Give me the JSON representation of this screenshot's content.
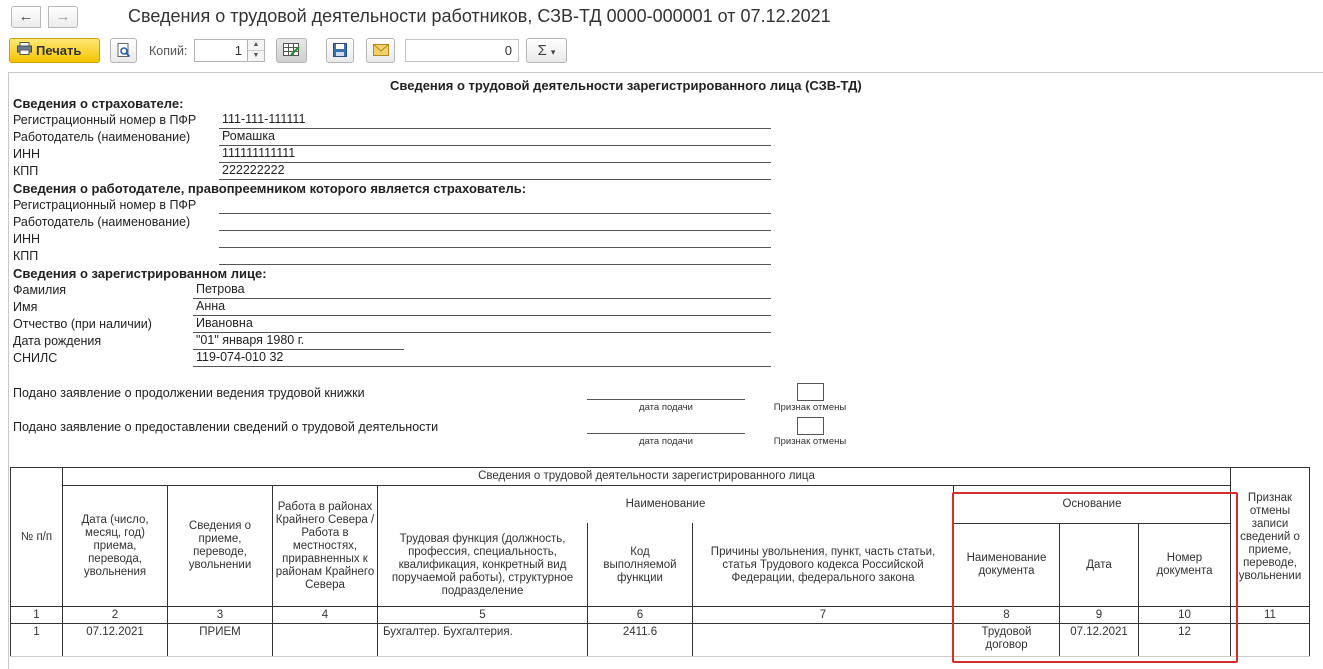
{
  "window": {
    "back": "←",
    "forward": "→",
    "title": "Сведения о трудовой деятельности работников, СЗВ-ТД 0000-000001 от 07.12.2021"
  },
  "toolbar": {
    "print_label": "Печать",
    "copies_label": "Копий:",
    "copies_value": "1",
    "sum_value": "0",
    "sigma": "Σ",
    "sigma_caret": "▾"
  },
  "document": {
    "title": "Сведения о трудовой деятельности зарегистрированного лица (СЗВ-ТД)",
    "insurer": {
      "heading": "Сведения о страхователе:",
      "fields": [
        {
          "label": "Регистрационный номер в ПФР",
          "value": "111-111-111111"
        },
        {
          "label": "Работодатель (наименование)",
          "value": "Ромашка"
        },
        {
          "label": "ИНН",
          "value": "111111111111"
        },
        {
          "label": "КПП",
          "value": "222222222"
        }
      ]
    },
    "predecessor": {
      "heading": "Сведения о работодателе, правопреемником которого является страхователь:",
      "fields": [
        {
          "label": "Регистрационный номер в ПФР",
          "value": ""
        },
        {
          "label": "Работодатель (наименование)",
          "value": ""
        },
        {
          "label": "ИНН",
          "value": ""
        },
        {
          "label": "КПП",
          "value": ""
        }
      ]
    },
    "person": {
      "heading": "Сведения о зарегистрированном лице:",
      "fields": [
        {
          "label": "Фамилия",
          "value": "Петрова"
        },
        {
          "label": "Имя",
          "value": "Анна"
        },
        {
          "label": "Отчество (при наличии)",
          "value": "Ивановна"
        },
        {
          "label": "Дата рождения",
          "value": "\"01\" января 1980 г."
        },
        {
          "label": "СНИЛС",
          "value": "119-074-010 32"
        }
      ]
    },
    "applications": [
      {
        "text": "Подано заявление о продолжении ведения трудовой книжки",
        "date_caption": "дата подачи",
        "cancel_caption": "Признак отмены"
      },
      {
        "text": "Подано заявление о предоставлении сведений о трудовой деятельности",
        "date_caption": "дата подачи",
        "cancel_caption": "Признак отмены"
      }
    ],
    "table": {
      "group_header": "Сведения о трудовой деятельности зарегистрированного лица",
      "name_header": "Наименование",
      "basis_header": "Основание",
      "col_no": "№ п/п",
      "col_date": "Дата (число, месяц, год) приема, перевода, увольнения",
      "col_info": "Сведения о приеме, переводе, увольнении",
      "col_north": "Работа в районах Крайнего Севера / Работа в местностях, приравненных к районам Крайнего Севера",
      "col_function": "Трудовая функция (должность, профессия, специальность, квалификация, конкретный вид поручаемой работы), структурное подразделение",
      "col_code": "Код выполняемой функции",
      "col_reason": "Причины увольнения, пункт, часть статьи, статья Трудового кодекса Российской Федерации, федерального закона",
      "col_doc_name": "Наименование документа",
      "col_doc_date": "Дата",
      "col_doc_number": "Номер документа",
      "col_cancel": "Признак отмены записи сведений о приеме, переводе, увольнении",
      "numbers": [
        "1",
        "2",
        "3",
        "4",
        "5",
        "6",
        "7",
        "8",
        "9",
        "10",
        "11"
      ],
      "rows": [
        {
          "no": "1",
          "date": "07.12.2021",
          "info": "ПРИЕМ",
          "north": "",
          "function": "Бухгалтер. Бухгалтерия.",
          "code": "2411.6",
          "reason": "",
          "doc_name": "Трудовой договор",
          "doc_date": "07.12.2021",
          "doc_number": "12",
          "cancel": ""
        }
      ]
    }
  }
}
